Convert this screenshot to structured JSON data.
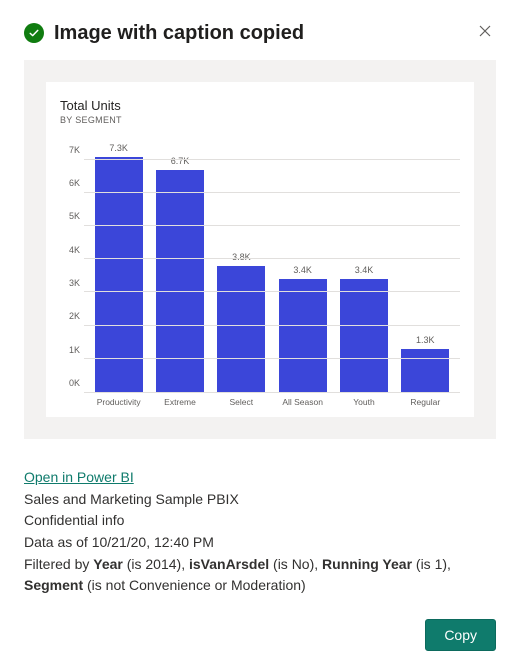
{
  "header": {
    "title": "Image with caption copied"
  },
  "chart_data": {
    "type": "bar",
    "title": "Total Units",
    "subtitle": "BY SEGMENT",
    "categories": [
      "Productivity",
      "Extreme",
      "Select",
      "All Season",
      "Youth",
      "Regular"
    ],
    "values": [
      7300,
      6700,
      3800,
      3400,
      3400,
      1300
    ],
    "value_labels": [
      "7.3K",
      "6.7K",
      "3.8K",
      "3.4K",
      "3.4K",
      "1.3K"
    ],
    "ylim": [
      0,
      7500
    ],
    "yticks": [
      0,
      1000,
      2000,
      3000,
      4000,
      5000,
      6000,
      7000
    ],
    "ytick_labels": [
      "0K",
      "1K",
      "2K",
      "3K",
      "4K",
      "5K",
      "6K",
      "7K"
    ],
    "bar_color": "#3b46d9"
  },
  "caption": {
    "link_text": "Open in Power BI",
    "report_name": "Sales and Marketing Sample PBIX",
    "classification": "Confidential info",
    "data_asof_prefix": "Data as of ",
    "data_asof": "10/21/20, 12:40 PM",
    "filter_prefix": "Filtered by ",
    "filters": [
      {
        "field": "Year",
        "cond": " (is 2014), "
      },
      {
        "field": "isVanArsdel",
        "cond": " (is No), "
      },
      {
        "field": "Running Year",
        "cond": " (is 1), "
      },
      {
        "field": "Segment",
        "cond": " (is not Convenience or Moderation)"
      }
    ]
  },
  "buttons": {
    "copy": "Copy"
  }
}
